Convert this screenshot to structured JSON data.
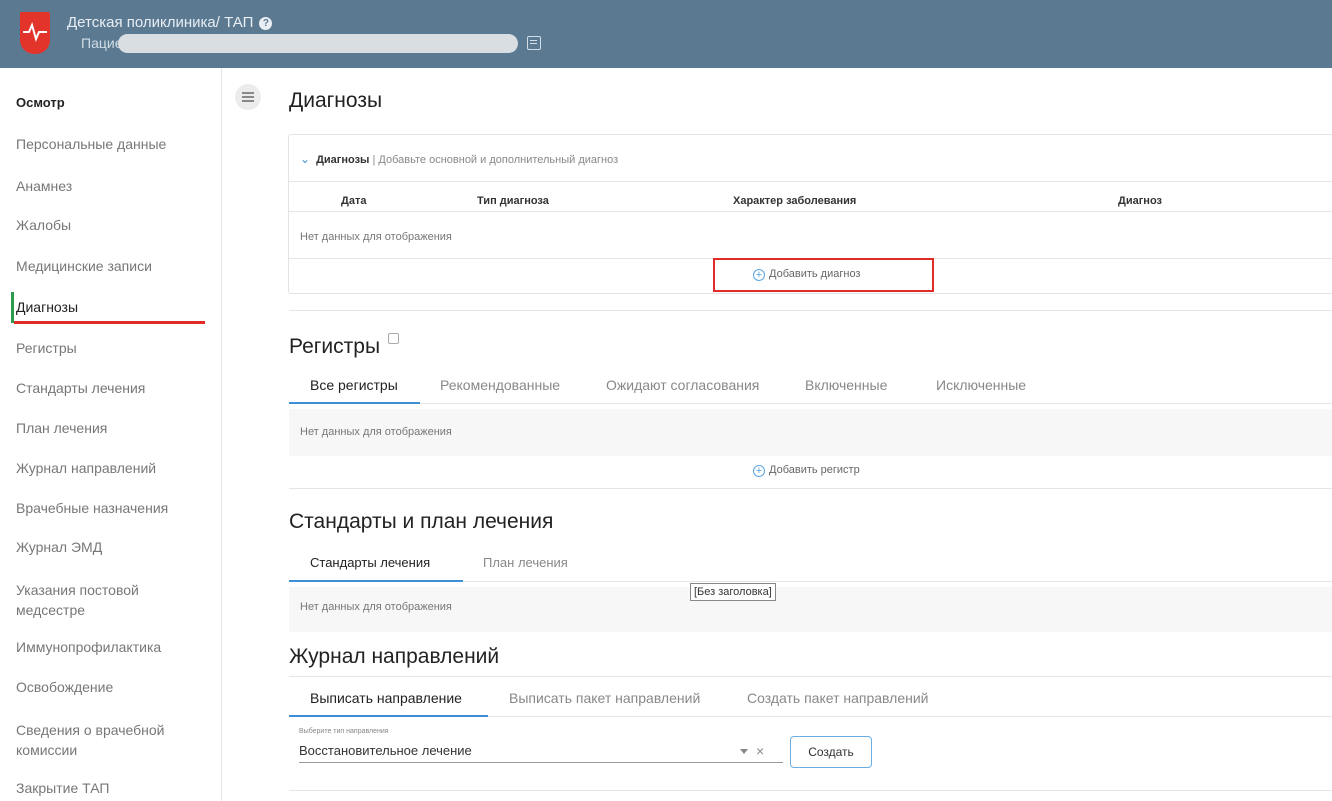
{
  "header": {
    "app_title": "Детская поликлиника/ ТАП",
    "help_icon": "?",
    "patient_label": "Пациент"
  },
  "sidebar": {
    "items": [
      {
        "label": "Осмотр"
      },
      {
        "label": "Персональные данные"
      },
      {
        "label": "Анамнез"
      },
      {
        "label": "Жалобы"
      },
      {
        "label": "Медицинские записи"
      },
      {
        "label": "Диагнозы"
      },
      {
        "label": "Регистры"
      },
      {
        "label": "Стандарты лечения"
      },
      {
        "label": "План лечения"
      },
      {
        "label": "Журнал направлений"
      },
      {
        "label": "Врачебные назначения"
      },
      {
        "label": "Журнал ЭМД"
      },
      {
        "label": "Указания постовой медсестре"
      },
      {
        "label": "Иммунопрофилактика"
      },
      {
        "label": "Освобождение"
      },
      {
        "label": "Сведения о врачебной комиссии"
      },
      {
        "label": "Закрытие ТАП"
      }
    ],
    "active_index": 5
  },
  "diagnoses": {
    "title": "Диагнозы",
    "panel_title": "Диагнозы",
    "panel_subtitle": "| Добавьте основной и дополнительный диагноз",
    "columns": [
      "Дата",
      "Тип диагноза",
      "Характер заболевания",
      "Диагноз"
    ],
    "empty_text": "Нет данных для отображения",
    "add_label": "Добавить диагноз"
  },
  "registers": {
    "title": "Регистры",
    "tabs": [
      "Все регистры",
      "Рекомендованные",
      "Ожидают согласования",
      "Включенные",
      "Исключенные"
    ],
    "active_tab": 0,
    "empty_text": "Нет данных для отображения",
    "add_label": "Добавить регистр"
  },
  "standards": {
    "title": "Стандарты и план лечения",
    "tabs": [
      "Стандарты лечения",
      "План лечения"
    ],
    "active_tab": 0,
    "empty_text": "Нет данных для отображения",
    "tooltip": "[Без заголовка]"
  },
  "referrals": {
    "title": "Журнал направлений",
    "tabs": [
      "Выписать направление",
      "Выписать пакет направлений",
      "Создать пакет направлений"
    ],
    "active_tab": 0,
    "select_label": "Выберите тип направления",
    "select_value": "Восстановительное лечение",
    "clear_symbol": "×",
    "create_button": "Создать"
  },
  "colors": {
    "header_bg": "#5b7a92",
    "accent_blue": "#3d90d6",
    "active_green": "#2d9a4e",
    "highlight_red": "#e02b27"
  }
}
